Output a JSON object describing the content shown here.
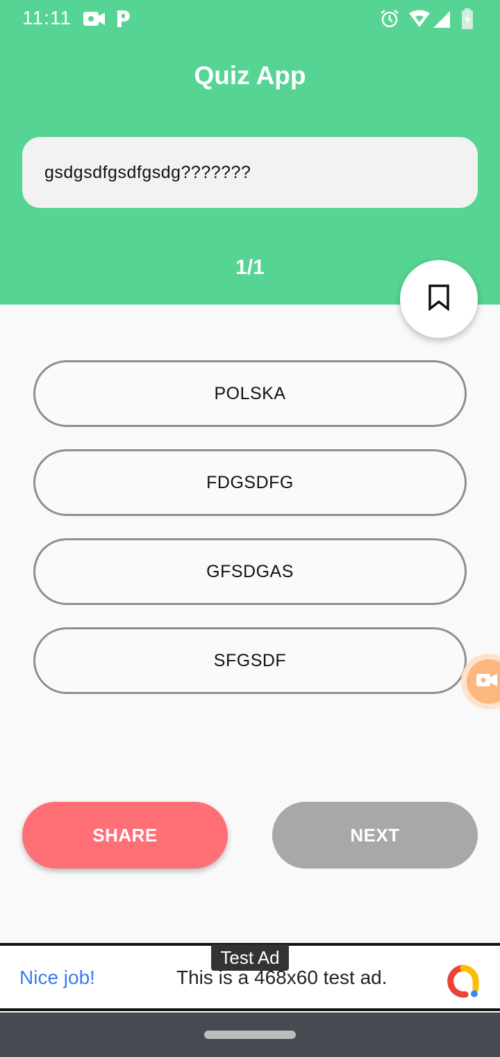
{
  "status_bar": {
    "time": "11:11",
    "icons": [
      "video-camera-icon",
      "parking-p-icon",
      "alarm-icon",
      "wifi-icon",
      "signal-icon",
      "battery-charging-icon"
    ]
  },
  "header": {
    "title": "Quiz App",
    "color": "#56d493"
  },
  "question": {
    "text": "gsdgsdfgsdfgsdg???????"
  },
  "progress": {
    "text": "1/1"
  },
  "options": [
    {
      "label": "POLSKA"
    },
    {
      "label": "FDGSDFG"
    },
    {
      "label": "GFSDGAS"
    },
    {
      "label": "SFGSDF"
    }
  ],
  "buttons": {
    "share_label": "SHARE",
    "share_color": "#fe6f76",
    "next_label": "NEXT",
    "next_color": "#a8a8a8"
  },
  "ad": {
    "badge": "Test Ad",
    "headline": "Nice job!",
    "body": "This is a 468x60 test ad."
  }
}
